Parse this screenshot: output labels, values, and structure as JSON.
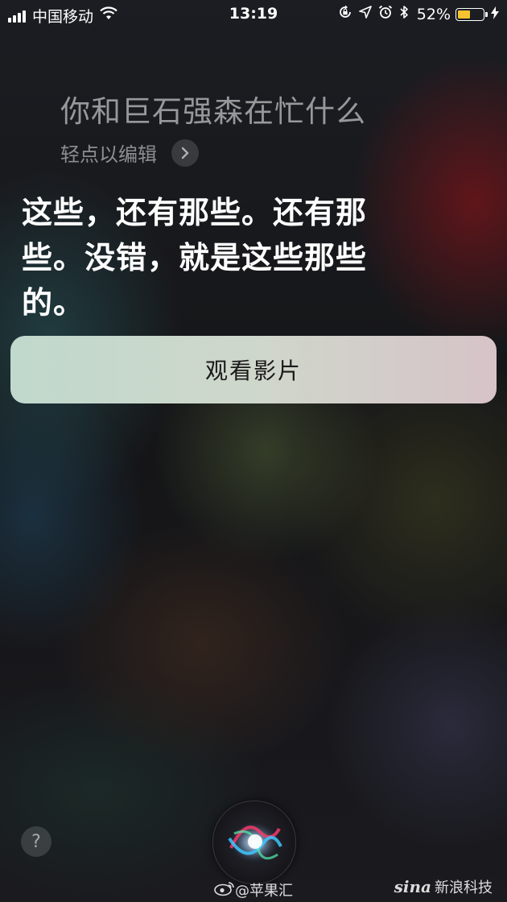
{
  "status_bar": {
    "carrier": "中国移动",
    "time": "13:19",
    "battery_percent": "52%",
    "battery_level": 0.52,
    "icons": [
      "signal-icon",
      "wifi-icon",
      "orientation-lock-icon",
      "location-icon",
      "alarm-icon",
      "bluetooth-icon",
      "battery-icon",
      "charging-bolt-icon"
    ]
  },
  "siri": {
    "query": "你和巨石强森在忙什么",
    "tap_to_edit": "轻点以编辑",
    "answer": "这些，还有那些。还有那些。没错，就是这些那些的。",
    "watch_button": "观看影片",
    "help_label": "?"
  },
  "watermarks": {
    "weibo": "@苹果汇",
    "sina_logo": "sina",
    "sina_text": "新浪科技"
  },
  "colors": {
    "button_gradient_start": "#c0d9cc",
    "button_gradient_end": "#d6c3c8",
    "battery_fill": "#f4c430"
  }
}
